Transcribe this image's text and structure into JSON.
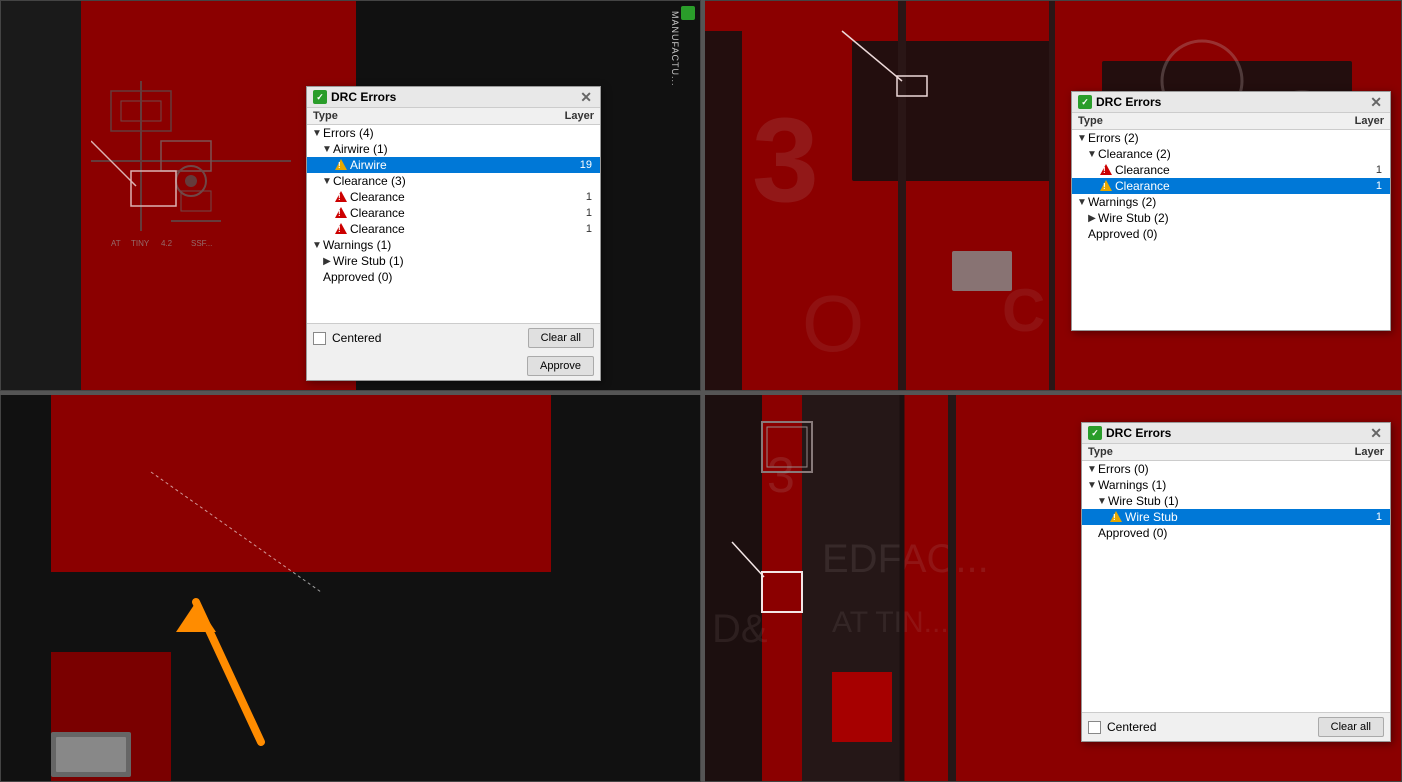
{
  "quadrants": {
    "q1": {
      "drc": {
        "title": "DRC Errors",
        "col_type": "Type",
        "col_layer": "Layer",
        "errors_label": "Errors (4)",
        "airwire_group": "Airwire (1)",
        "airwire_item": "Airwire",
        "airwire_layer": "19",
        "clearance_group": "Clearance (3)",
        "clearance_items": [
          "Clearance",
          "Clearance",
          "Clearance"
        ],
        "clearance_layers": [
          "1",
          "1",
          "1"
        ],
        "warnings_label": "Warnings (1)",
        "wirestub_group": "Wire Stub (1)",
        "approved_label": "Approved (0)",
        "centered_label": "Centered",
        "clear_all_label": "Clear all",
        "approve_label": "Approve"
      }
    },
    "q2": {
      "drc": {
        "title": "DRC Errors",
        "col_type": "Type",
        "col_layer": "Layer",
        "errors_label": "Errors (2)",
        "clearance_group": "Clearance (2)",
        "clearance_item1": "Clearance",
        "clearance_item1_layer": "1",
        "clearance_item2": "Clearance",
        "clearance_item2_layer": "1",
        "warnings_label": "Warnings (2)",
        "wirestub_group": "Wire Stub (2)",
        "approved_label": "Approved (0)"
      }
    },
    "q3": {
      "arrow_color": "#ff8c00"
    },
    "q4": {
      "drc": {
        "title": "DRC Errors",
        "col_type": "Type",
        "col_layer": "Layer",
        "errors_label": "Errors (0)",
        "warnings_label": "Warnings (1)",
        "wirestub_group": "Wire Stub (1)",
        "wirestub_item": "Wire Stub",
        "wirestub_layer": "1",
        "approved_label": "Approved (0)",
        "centered_label": "Centered",
        "clear_all_label": "Clear all"
      }
    }
  }
}
